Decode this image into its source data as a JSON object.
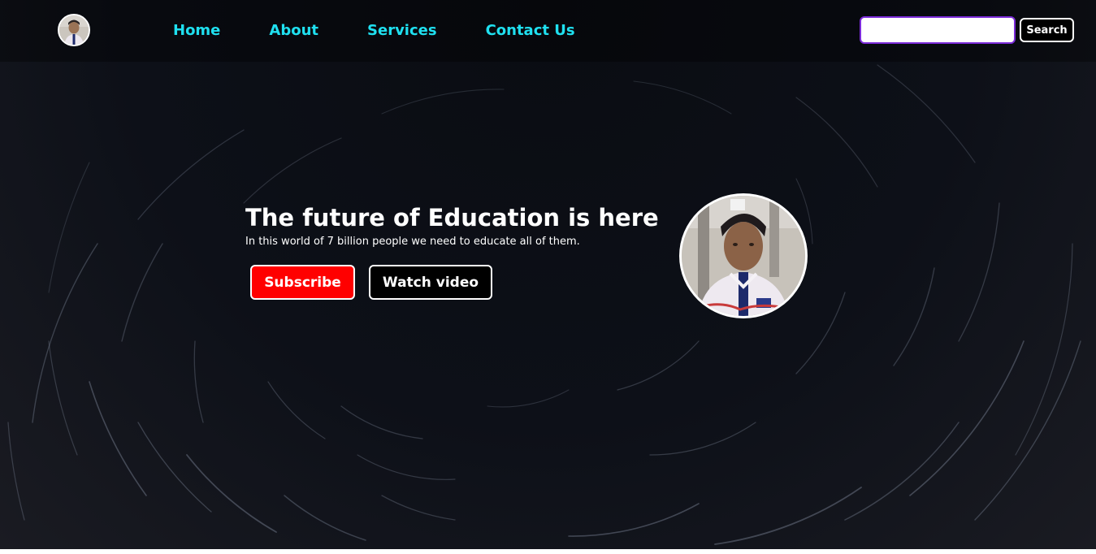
{
  "nav": {
    "logo_icon": "profile-photo-icon",
    "links": [
      {
        "label": "Home"
      },
      {
        "label": "About"
      },
      {
        "label": "Services"
      },
      {
        "label": "Contact Us"
      }
    ],
    "search": {
      "value": "",
      "placeholder": "",
      "button_label": "Search"
    }
  },
  "hero": {
    "title": "The future of Education is here",
    "subtitle": "In this world of 7 billion people we need to educate all of them.",
    "subscribe_label": "Subscribe",
    "watch_label": "Watch video",
    "image_icon": "profile-photo-icon"
  },
  "colors": {
    "nav_link": "#1fe0f0",
    "subscribe_bg": "#ff0000",
    "search_border": "#7b2bd8"
  }
}
